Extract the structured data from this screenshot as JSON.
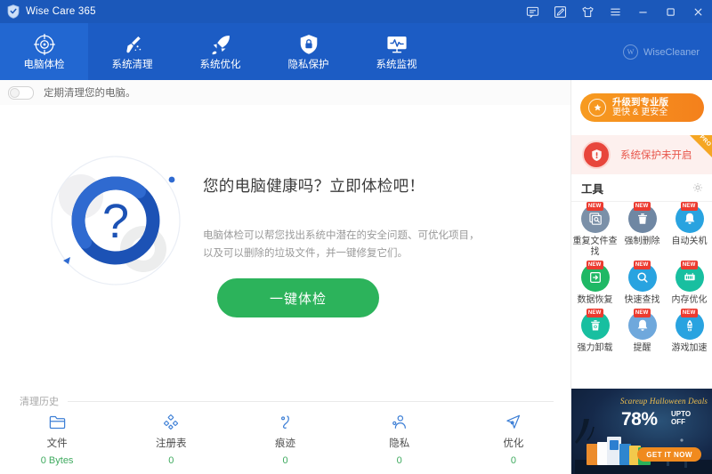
{
  "window": {
    "title": "Wise Care 365",
    "logo_icon": "shield-icon",
    "buttons": [
      {
        "name": "feedback-icon",
        "label": "Feedback"
      },
      {
        "name": "edit-icon",
        "label": "Edit"
      },
      {
        "name": "skin-shirt-icon",
        "label": "Skin"
      },
      {
        "name": "menu-icon",
        "label": "Menu"
      },
      {
        "name": "minimize-icon",
        "label": "Minimize"
      },
      {
        "name": "maximize-icon",
        "label": "Maximize"
      },
      {
        "name": "close-icon",
        "label": "Close"
      }
    ]
  },
  "nav": {
    "items": [
      {
        "label": "电脑体检",
        "icon": "checkup-target-icon",
        "active": true
      },
      {
        "label": "系统清理",
        "icon": "broom-icon",
        "active": false
      },
      {
        "label": "系统优化",
        "icon": "rocket-icon",
        "active": false
      },
      {
        "label": "隐私保护",
        "icon": "shield-lock-icon",
        "active": false
      },
      {
        "label": "系统监视",
        "icon": "monitor-pulse-icon",
        "active": false
      }
    ],
    "brand": {
      "mark": "W",
      "name": "WiseCleaner"
    }
  },
  "subbar": {
    "toggle_state": "off",
    "text": "定期清理您的电脑。"
  },
  "main": {
    "art_icon": "question-mark-circle",
    "art_glyph": "?",
    "title": "您的电脑健康吗？立即体检吧！",
    "description": "电脑体检可以帮您找出系统中潜在的安全问题、可优化项目，以及可以删除的垃圾文件，并一键修复它们。",
    "scan_button": "一键体检"
  },
  "history": {
    "heading": "清理历史",
    "items": [
      {
        "icon": "folder-icon",
        "name": "文件",
        "value": "0 Bytes"
      },
      {
        "icon": "registry-icon",
        "name": "注册表",
        "value": "0"
      },
      {
        "icon": "footprint-icon",
        "name": "痕迹",
        "value": "0"
      },
      {
        "icon": "privacy-person-icon",
        "name": "隐私",
        "value": "0"
      },
      {
        "icon": "optimize-icon",
        "name": "优化",
        "value": "0"
      }
    ]
  },
  "sidebar": {
    "upgrade": {
      "icon": "upgrade-badge-icon",
      "line1": "升级到专业版",
      "line2": "更快 & 更安全"
    },
    "protection": {
      "icon": "shield-alert-icon",
      "text": "系统保护未开启",
      "corner_badge": "PRO"
    },
    "tools": {
      "heading": "工具",
      "settings_icon": "gear-icon",
      "items": [
        {
          "name": "重复文件查找",
          "icon": "duplicate-file-icon",
          "badge": "NEW",
          "color": "#7b90a8"
        },
        {
          "name": "强制删除",
          "icon": "force-delete-trash-icon",
          "badge": "NEW",
          "color": "#6f87a3"
        },
        {
          "name": "自动关机",
          "icon": "auto-shutdown-bell-icon",
          "badge": "NEW",
          "color": "#29a3e0"
        },
        {
          "name": "数据恢复",
          "icon": "data-recovery-icon",
          "badge": "NEW",
          "color": "#1fb865"
        },
        {
          "name": "快速查找",
          "icon": "quick-search-icon",
          "badge": "NEW",
          "color": "#29a3e0"
        },
        {
          "name": "内存优化",
          "icon": "memory-optimize-icon",
          "badge": "NEW",
          "color": "#18bfa0"
        },
        {
          "name": "强力卸载",
          "icon": "uninstall-trash-icon",
          "badge": "NEW",
          "color": "#18bfa0"
        },
        {
          "name": "提醒",
          "icon": "reminder-bell-icon",
          "badge": "NEW",
          "color": "#6fa8dc"
        },
        {
          "name": "游戏加速",
          "icon": "game-boost-icon",
          "badge": "NEW",
          "color": "#29a3e0"
        }
      ]
    },
    "ad": {
      "title": "Scareup Halloween Deals",
      "percent": "78%",
      "upto": "UPTO",
      "off": "OFF",
      "cta": "GET IT NOW"
    }
  },
  "colors": {
    "titlebar": "#1b58ba",
    "navbar": "#1c5cc4",
    "nav_active": "#2267d1",
    "accent_green": "#2cb35b",
    "accent_orange": "#f4801c",
    "alert_red": "#e8463c",
    "value_green": "#3faa5f"
  }
}
